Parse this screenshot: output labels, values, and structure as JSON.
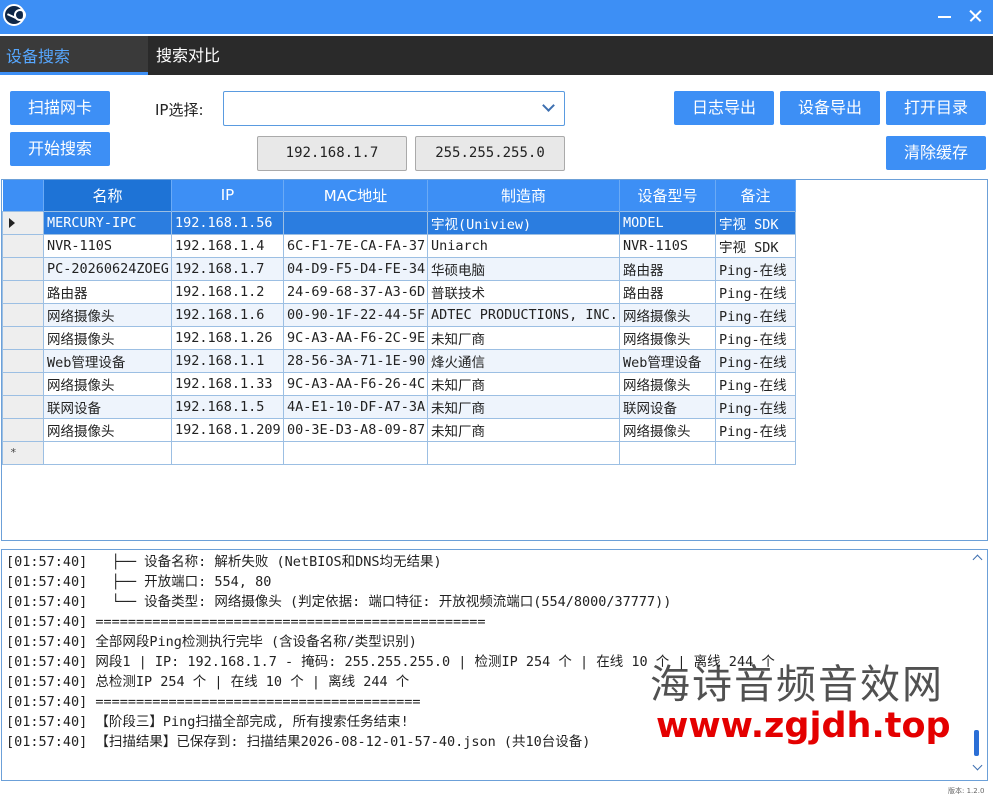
{
  "tabs": [
    {
      "label": "设备搜索",
      "active": true
    },
    {
      "label": "搜索对比",
      "active": false
    }
  ],
  "toolbar": {
    "scan_nic": "扫描网卡",
    "start_search": "开始搜索",
    "ip_label": "IP选择:",
    "ip_select_value": "",
    "ip_address": "192.168.1.7",
    "subnet_mask": "255.255.255.0",
    "log_export": "日志导出",
    "device_export": "设备导出",
    "open_dir": "打开目录",
    "clear_cache": "清除缓存"
  },
  "grid": {
    "columns": [
      "名称",
      "IP",
      "MAC地址",
      "制造商",
      "设备型号",
      "备注"
    ],
    "rows": [
      [
        "MERCURY-IPC",
        "192.168.1.56",
        "",
        "宇视(Uniview)",
        "MODEL",
        "宇视 SDK"
      ],
      [
        "NVR-110S",
        "192.168.1.4",
        "6C-F1-7E-CA-FA-37",
        "Uniarch",
        "NVR-110S",
        "宇视 SDK"
      ],
      [
        "PC-20260624ZOEG",
        "192.168.1.7",
        "04-D9-F5-D4-FE-34",
        "华硕电脑",
        "路由器",
        "Ping-在线"
      ],
      [
        "路由器",
        "192.168.1.2",
        "24-69-68-37-A3-6D",
        "普联技术",
        "路由器",
        "Ping-在线"
      ],
      [
        "网络摄像头",
        "192.168.1.6",
        "00-90-1F-22-44-5F",
        "ADTEC PRODUCTIONS, INC.",
        "网络摄像头",
        "Ping-在线"
      ],
      [
        "网络摄像头",
        "192.168.1.26",
        "9C-A3-AA-F6-2C-9E",
        "未知厂商",
        "网络摄像头",
        "Ping-在线"
      ],
      [
        "Web管理设备",
        "192.168.1.1",
        "28-56-3A-71-1E-90",
        "烽火通信",
        "Web管理设备",
        "Ping-在线"
      ],
      [
        "网络摄像头",
        "192.168.1.33",
        "9C-A3-AA-F6-26-4C",
        "未知厂商",
        "网络摄像头",
        "Ping-在线"
      ],
      [
        "联网设备",
        "192.168.1.5",
        "4A-E1-10-DF-A7-3A",
        "未知厂商",
        "联网设备",
        "Ping-在线"
      ],
      [
        "网络摄像头",
        "192.168.1.209",
        "00-3E-D3-A8-09-87",
        "未知厂商",
        "网络摄像头",
        "Ping-在线"
      ]
    ]
  },
  "log": [
    "[01:57:40]   ├── 设备名称: 解析失败 (NetBIOS和DNS均无结果)",
    "[01:57:40]   ├── 开放端口: 554, 80",
    "[01:57:40]   └── 设备类型: 网络摄像头 (判定依据: 端口特征: 开放视频流端口(554/8000/37777))",
    "[01:57:40] ================================================",
    "[01:57:40] 全部网段Ping检测执行完毕 (含设备名称/类型识别)",
    "[01:57:40] 网段1 | IP: 192.168.1.7 - 掩码: 255.255.255.0 | 检测IP 254 个 | 在线 10 个 | 离线 244 个",
    "[01:57:40] 总检测IP 254 个 | 在线 10 个 | 离线 244 个",
    "[01:57:40] ========================================",
    "[01:57:40] 【阶段三】Ping扫描全部完成, 所有搜索任务结束!",
    "[01:57:40] 【扫描结果】已保存到: 扫描结果2026-08-12-01-57-40.json (共10台设备)"
  ],
  "watermark": {
    "line1": "海诗音频音效网",
    "line2": "www.zgjdh.top"
  },
  "version": "版本: 1.2.0",
  "colors": {
    "accent": "#3d8ff5",
    "selected_row": "#2b7de0",
    "tabstrip": "#2a2a2a",
    "watermark_red": "#e40000"
  }
}
